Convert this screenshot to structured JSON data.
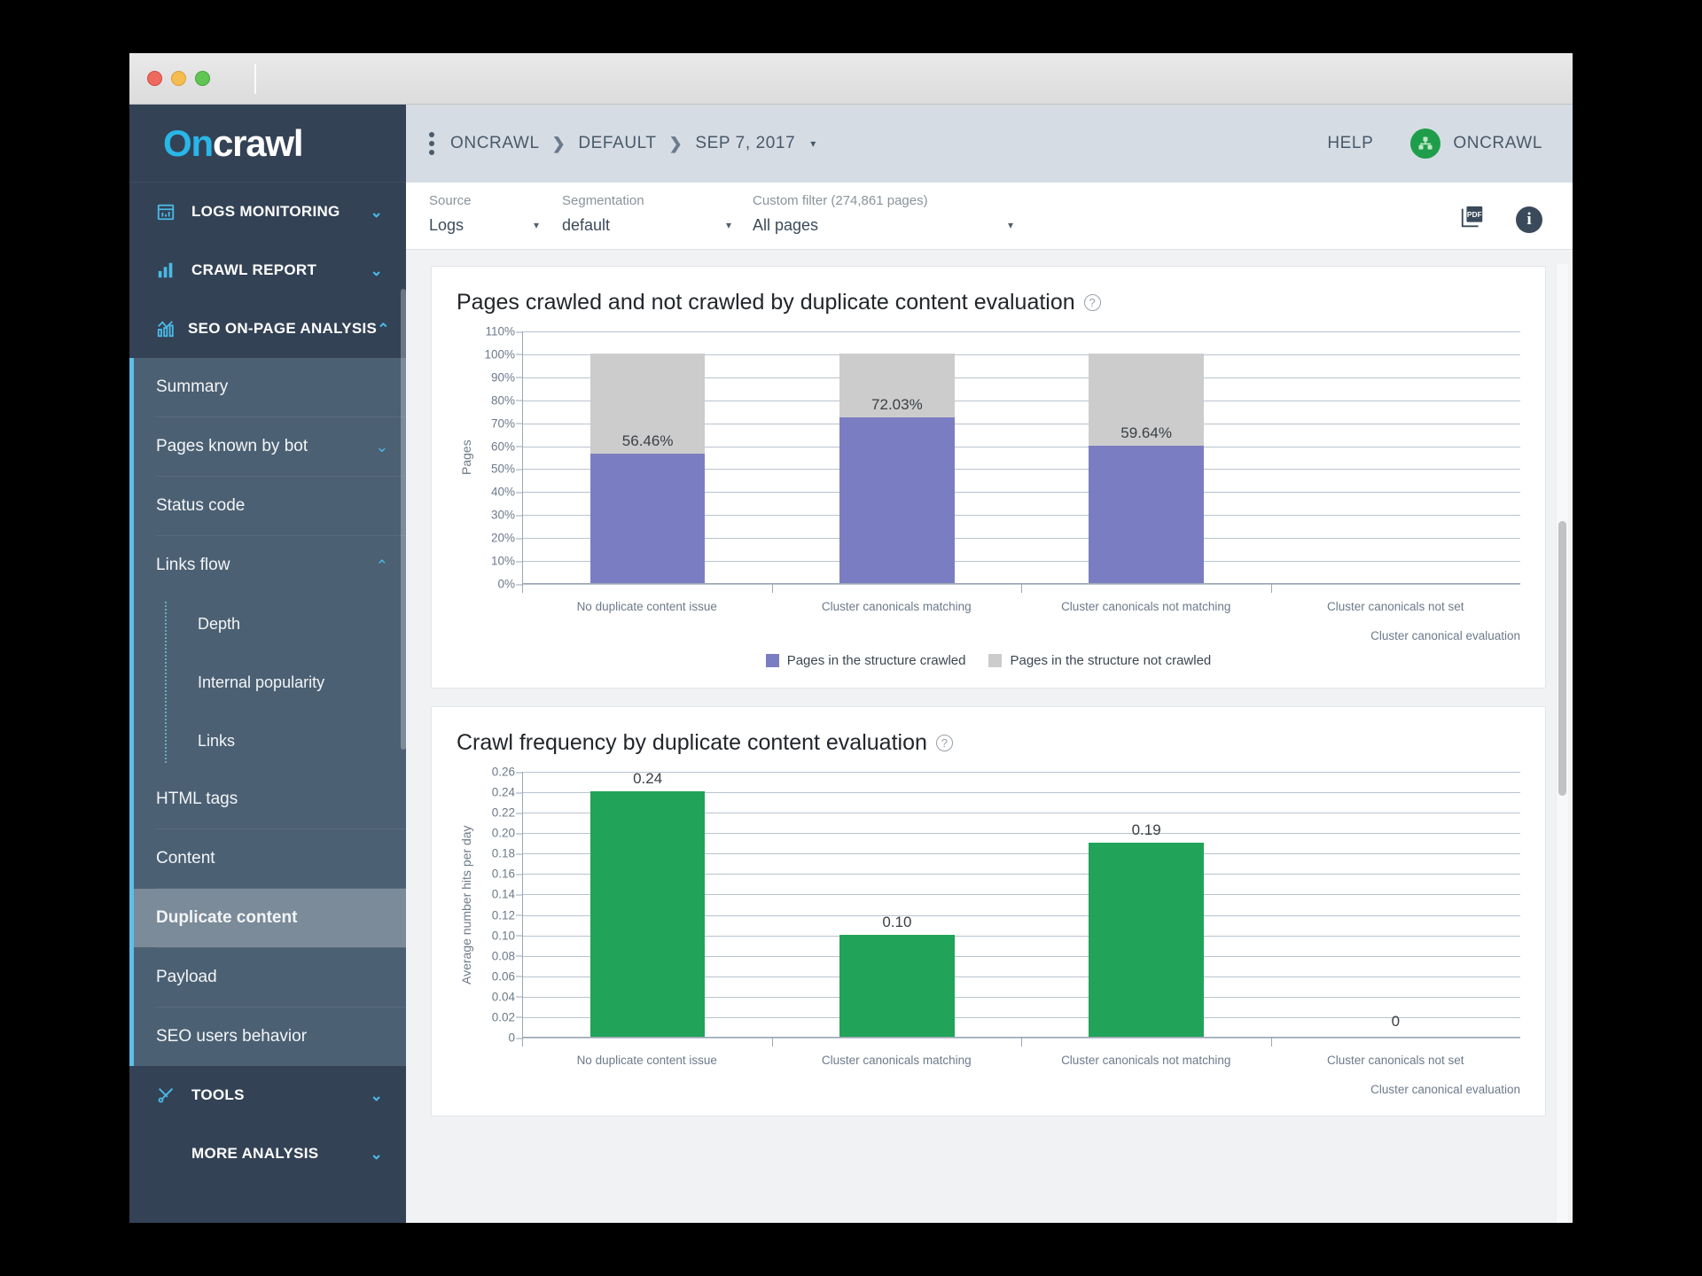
{
  "window": {
    "traffic_lights": [
      "close",
      "minimize",
      "zoom"
    ]
  },
  "sidebar": {
    "logo": {
      "part1": "On",
      "part2": "c",
      "part3": "rawl"
    },
    "groups": [
      {
        "label": "LOGS MONITORING",
        "icon": "calendar-chart-icon",
        "chevron": "⌄"
      },
      {
        "label": "CRAWL REPORT",
        "icon": "bar-chart-icon",
        "chevron": "⌄"
      },
      {
        "label": "SEO ON-PAGE ANALYSIS",
        "icon": "line-chart-icon",
        "chevron": "⌃"
      }
    ],
    "items": [
      {
        "label": "Summary",
        "level": 1,
        "active": false,
        "chevron": ""
      },
      {
        "label": "Pages known by bot",
        "level": 1,
        "active": false,
        "chevron": "⌄"
      },
      {
        "label": "Status code",
        "level": 1,
        "active": false,
        "chevron": ""
      },
      {
        "label": "Links flow",
        "level": 1,
        "active": false,
        "chevron": "⌃"
      },
      {
        "label": "Depth",
        "level": 2,
        "active": false,
        "chevron": ""
      },
      {
        "label": "Internal popularity",
        "level": 2,
        "active": false,
        "chevron": ""
      },
      {
        "label": "Links",
        "level": 2,
        "active": false,
        "chevron": ""
      },
      {
        "label": "HTML tags",
        "level": 1,
        "active": false,
        "chevron": ""
      },
      {
        "label": "Content",
        "level": 1,
        "active": false,
        "chevron": ""
      },
      {
        "label": "Duplicate content",
        "level": 1,
        "active": true,
        "chevron": ""
      },
      {
        "label": "Payload",
        "level": 1,
        "active": false,
        "chevron": ""
      },
      {
        "label": "SEO users behavior",
        "level": 1,
        "active": false,
        "chevron": ""
      }
    ],
    "groups_bottom": [
      {
        "label": "TOOLS",
        "icon": "tools-icon",
        "chevron": "⌄"
      },
      {
        "label": "MORE ANALYSIS",
        "icon": "",
        "chevron": "⌄"
      }
    ]
  },
  "topbar": {
    "kebab": "kebab-menu",
    "breadcrumbs": [
      "ONCRAWL",
      "DEFAULT",
      "SEP 7, 2017"
    ],
    "breadcrumb_separator": "❯",
    "date_caret": "▾",
    "help_label": "HELP",
    "user_name": "ONCRAWL"
  },
  "filters": [
    {
      "label": "Source",
      "value": "Logs",
      "caret": "▾"
    },
    {
      "label": "Segmentation",
      "value": "default",
      "caret": "▾"
    },
    {
      "label": "Custom filter (274,861 pages)",
      "value": "All pages",
      "caret": "▾"
    }
  ],
  "filter_actions": {
    "pdf": "PDF",
    "info": "i"
  },
  "chart_data": [
    {
      "type": "bar",
      "stacked": true,
      "title": "Pages crawled and not crawled by duplicate content evaluation",
      "help": "?",
      "xlabel": "Cluster canonical evaluation",
      "ylabel": "Pages",
      "categories": [
        "No duplicate content issue",
        "Cluster canonicals matching",
        "Cluster canonicals not matching",
        "Cluster canonicals not set"
      ],
      "yticks": [
        "110%",
        "100%",
        "90%",
        "80%",
        "70%",
        "60%",
        "50%",
        "40%",
        "30%",
        "20%",
        "10%",
        "0%"
      ],
      "ylim": [
        0,
        110
      ],
      "grid": true,
      "legend_position": "bottom",
      "series": [
        {
          "name": "Pages in the structure crawled",
          "color": "#7b7dc2",
          "values": [
            56.46,
            72.03,
            59.64,
            0
          ],
          "labels": [
            "56.46%",
            "72.03%",
            "59.64%",
            ""
          ]
        },
        {
          "name": "Pages in the structure not crawled",
          "color": "#cccccc",
          "values": [
            43.54,
            27.97,
            40.36,
            0
          ],
          "labels": [
            "",
            "",
            "",
            ""
          ]
        }
      ]
    },
    {
      "type": "bar",
      "stacked": false,
      "title": "Crawl frequency by duplicate content evaluation",
      "help": "?",
      "xlabel": "Cluster canonical evaluation",
      "ylabel": "Average number hits per day",
      "categories": [
        "No duplicate content issue",
        "Cluster canonicals matching",
        "Cluster canonicals not matching",
        "Cluster canonicals not set"
      ],
      "yticks": [
        "0.26",
        "0.24",
        "0.22",
        "0.20",
        "0.18",
        "0.16",
        "0.14",
        "0.12",
        "0.10",
        "0.08",
        "0.06",
        "0.04",
        "0.02",
        "0"
      ],
      "ylim": [
        0,
        0.26
      ],
      "grid": true,
      "legend_position": "none",
      "series": [
        {
          "name": "Average number hits per day",
          "color": "#21a359",
          "values": [
            0.24,
            0.1,
            0.19,
            0
          ],
          "labels": [
            "0.24",
            "0.10",
            "0.19",
            "0"
          ]
        }
      ]
    }
  ]
}
